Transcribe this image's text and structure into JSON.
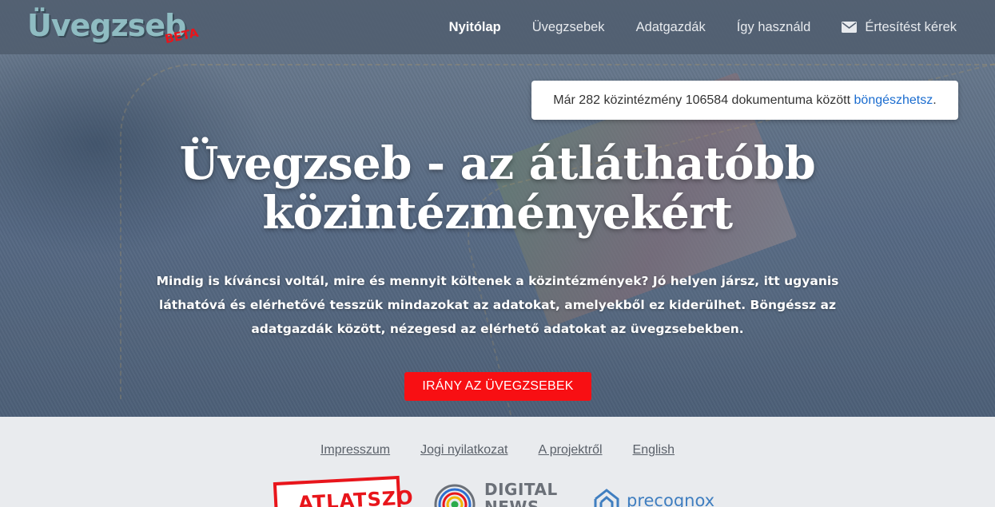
{
  "brand": {
    "logo_text": "Üvegzseb",
    "beta_label": "BETA"
  },
  "nav": {
    "items": [
      {
        "label": "Nyitólap",
        "active": true
      },
      {
        "label": "Üvegzsebek",
        "active": false
      },
      {
        "label": "Adatgazdák",
        "active": false
      },
      {
        "label": "Így használd",
        "active": false
      },
      {
        "label": "Értesítést kérek",
        "active": false,
        "icon": "envelope-icon"
      }
    ]
  },
  "notice": {
    "text_before": "Már 282 közintézmény 106584 dokumentuma között ",
    "link_text": "böngészhetsz",
    "text_after": "."
  },
  "hero": {
    "title_line1": "Üvegzseb - az átláthatóbb",
    "title_line2": "közintézményekért",
    "description": "Mindig is kíváncsi voltál, mire és mennyit költenek a közintézmények? Jó helyen jársz, itt ugyanis láthatóvá és elérhetővé tesszük mindazokat az adatokat, amelyekből ez kiderülhet. Böngéssz az adatgazdák között, nézegesd az elérhető adatokat az üvegzsebekben.",
    "cta_label": "IRÁNY AZ ÜVEGZSEBEK"
  },
  "footer": {
    "links": [
      "Impresszum",
      "Jogi nyilatkozat",
      "A projektről",
      "English"
    ],
    "partners": {
      "atlatszo": "ATLATSZO",
      "digital_news_line1": "DIGITAL",
      "digital_news_line2": "NEWS",
      "precognox": "precognox"
    }
  },
  "colors": {
    "accent_red": "#f80f13",
    "link_blue": "#1a6ccf",
    "logo_teal": "#8fbcc2"
  }
}
